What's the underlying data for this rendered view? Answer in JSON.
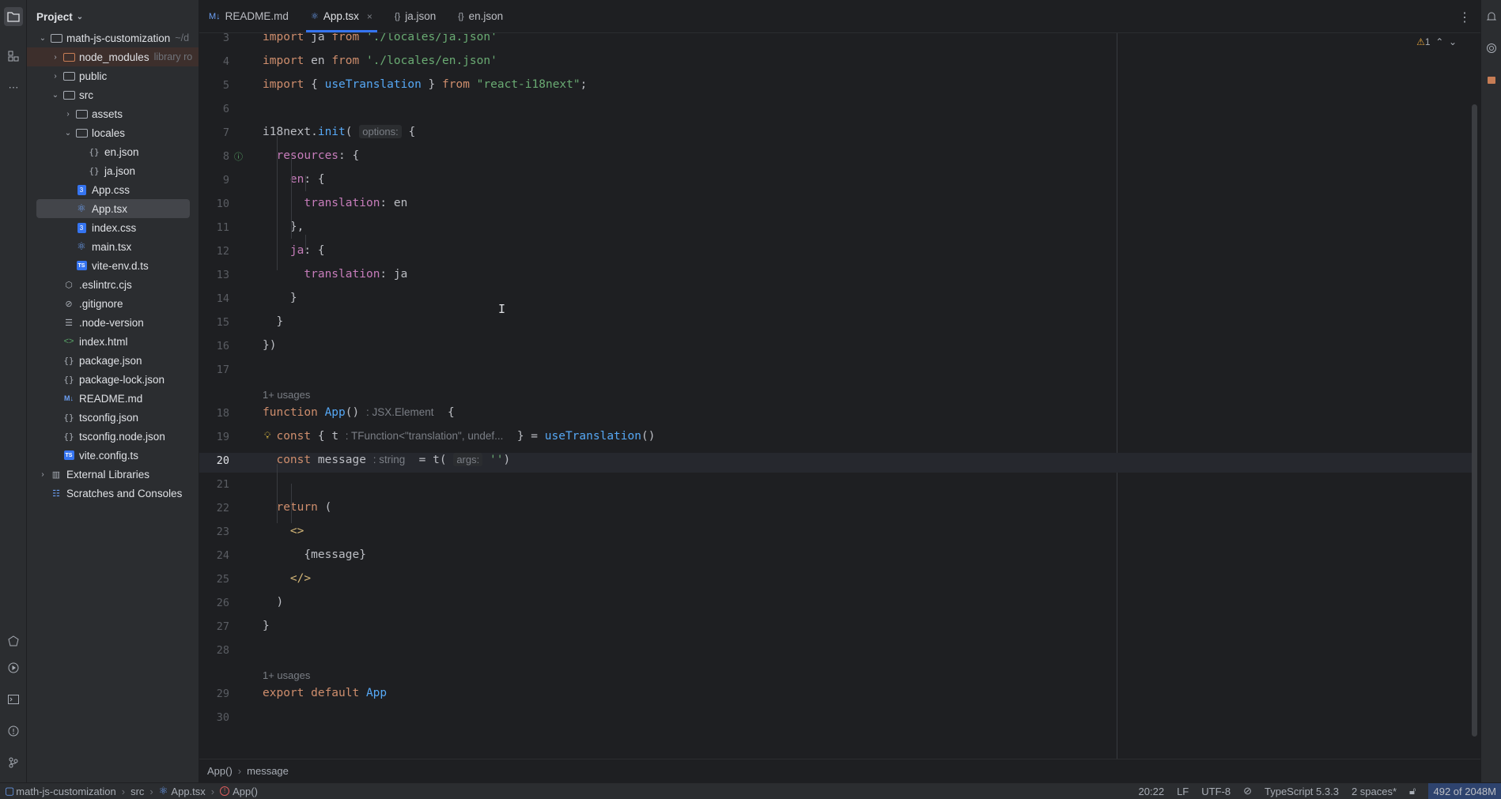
{
  "project_panel": {
    "title": "Project",
    "tree": [
      {
        "label": "math-js-customization",
        "hint": "~/d",
        "type": "folder",
        "level": 0,
        "arrow": "v"
      },
      {
        "label": "node_modules",
        "hint": "library ro",
        "type": "folder-orange",
        "level": 1,
        "arrow": ">"
      },
      {
        "label": "public",
        "type": "folder",
        "level": 1,
        "arrow": ">"
      },
      {
        "label": "src",
        "type": "folder",
        "level": 1,
        "arrow": "v"
      },
      {
        "label": "assets",
        "type": "folder",
        "level": 2,
        "arrow": ">"
      },
      {
        "label": "locales",
        "type": "folder",
        "level": 2,
        "arrow": "v"
      },
      {
        "label": "en.json",
        "type": "json",
        "level": 3
      },
      {
        "label": "ja.json",
        "type": "json",
        "level": 3
      },
      {
        "label": "App.css",
        "type": "css",
        "level": 2
      },
      {
        "label": "App.tsx",
        "type": "react",
        "level": 2,
        "selected": true
      },
      {
        "label": "index.css",
        "type": "css",
        "level": 2
      },
      {
        "label": "main.tsx",
        "type": "react",
        "level": 2
      },
      {
        "label": "vite-env.d.ts",
        "type": "ts",
        "level": 2
      },
      {
        "label": ".eslintrc.cjs",
        "type": "eslint",
        "level": 1
      },
      {
        "label": ".gitignore",
        "type": "ignore",
        "level": 1
      },
      {
        "label": ".node-version",
        "type": "text",
        "level": 1
      },
      {
        "label": "index.html",
        "type": "html",
        "level": 1
      },
      {
        "label": "package.json",
        "type": "json",
        "level": 1
      },
      {
        "label": "package-lock.json",
        "type": "json",
        "level": 1
      },
      {
        "label": "README.md",
        "type": "md",
        "level": 1
      },
      {
        "label": "tsconfig.json",
        "type": "json",
        "level": 1
      },
      {
        "label": "tsconfig.node.json",
        "type": "json",
        "level": 1
      },
      {
        "label": "vite.config.ts",
        "type": "ts",
        "level": 1
      },
      {
        "label": "External Libraries",
        "type": "lib",
        "level": 0,
        "arrow": ">"
      },
      {
        "label": "Scratches and Consoles",
        "type": "scratch",
        "level": 0
      }
    ]
  },
  "tabs": [
    {
      "label": "README.md",
      "icon": "M↓"
    },
    {
      "label": "App.tsx",
      "icon": "⚛",
      "active": true,
      "close": "×"
    },
    {
      "label": "ja.json",
      "icon": "{}"
    },
    {
      "label": "en.json",
      "icon": "{}"
    }
  ],
  "inspection": {
    "warnings": "1",
    "up": "⌃",
    "down": "⌄"
  },
  "code": {
    "current_line": "20",
    "lines": [
      {
        "n": "3",
        "html": "<span class='kw'>import</span> ja <span class='kw'>from</span> <span class='str'>'./locales/ja.json'</span>"
      },
      {
        "n": "4",
        "html": "<span class='kw'>import</span> en <span class='kw'>from</span> <span class='str'>'./locales/en.json'</span>"
      },
      {
        "n": "5",
        "html": "<span class='kw'>import</span> { <span class='fn'>useTranslation</span> } <span class='kw'>from</span> <span class='str'>\"react-i18next\"</span>;"
      },
      {
        "n": "6",
        "html": ""
      },
      {
        "n": "7",
        "html": "i18next.<span class='fn'>init</span>( <span class='hint-inline'>options:</span> {"
      },
      {
        "n": "8",
        "html": "  <span class='prop'>resources</span>: {"
      },
      {
        "n": "9",
        "html": "    <span class='prop'>en</span>: {"
      },
      {
        "n": "10",
        "html": "      <span class='prop'>translation</span>: en"
      },
      {
        "n": "11",
        "html": "    },"
      },
      {
        "n": "12",
        "html": "    <span class='prop'>ja</span>: {"
      },
      {
        "n": "13",
        "html": "      <span class='prop'>translation</span>: ja"
      },
      {
        "n": "14",
        "html": "    }"
      },
      {
        "n": "15",
        "html": "  }"
      },
      {
        "n": "16",
        "html": "})"
      },
      {
        "n": "17",
        "html": ""
      },
      {
        "usages": "1+ usages"
      },
      {
        "n": "18",
        "html": "<span class='kw'>function</span> <span class='fn'>App</span>() <span class='hint-plain'>: JSX.Element</span>  {"
      },
      {
        "n": "19",
        "html": "  <span class='kw'>const</span> { t <span class='hint-plain'>: TFunction&lt;\"translation\", undef...</span>  } = <span class='fn'>useTranslation</span>()"
      },
      {
        "n": "20",
        "html": "  <span class='kw'>const</span> message <span class='hint-plain'>: string</span>  = t( <span class='hint-inline'>args:</span> <span class='str'>''</span>)"
      },
      {
        "n": "21",
        "html": ""
      },
      {
        "n": "22",
        "html": "  <span class='kw'>return</span> ("
      },
      {
        "n": "23",
        "html": "    <span class='tag'>&lt;&gt;</span>"
      },
      {
        "n": "24",
        "html": "      {message}"
      },
      {
        "n": "25",
        "html": "    <span class='tag'>&lt;/&gt;</span>"
      },
      {
        "n": "26",
        "html": "  )"
      },
      {
        "n": "27",
        "html": "}"
      },
      {
        "n": "28",
        "html": ""
      },
      {
        "usages": "1+ usages"
      },
      {
        "n": "29",
        "html": "<span class='kw'>export default</span> <span class='fn'>App</span>"
      },
      {
        "n": "30",
        "html": ""
      }
    ]
  },
  "editor_breadcrumbs": [
    "App()",
    "message"
  ],
  "status_bar": {
    "path": [
      "math-js-customization",
      "src",
      "App.tsx",
      "App()"
    ],
    "position": "20:22",
    "line_sep": "LF",
    "encoding": "UTF-8",
    "language": "TypeScript 5.3.3",
    "indent": "2 spaces*",
    "memory": "492 of 2048M"
  }
}
